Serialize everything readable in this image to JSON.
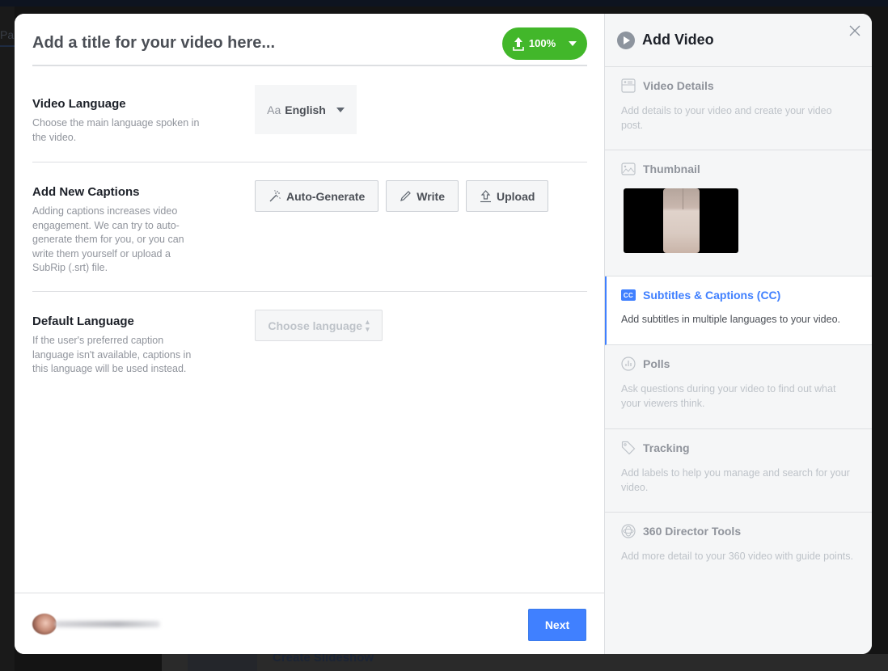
{
  "background": {
    "tab_fragment": "Pa",
    "bottom_item": "Create Slideshow"
  },
  "header": {
    "title": "Add a title for your video here...",
    "upload_progress_label": "100%",
    "upload_progress_percent": 100,
    "upload_color": "#42b72a"
  },
  "sections": {
    "video_language": {
      "title": "Video Language",
      "description": "Choose the main language spoken in the video.",
      "select_prefix": "Aa",
      "selected": "English"
    },
    "add_captions": {
      "title": "Add New Captions",
      "description": "Adding captions increases video engagement. We can try to auto-generate them for you, or you can write them yourself or upload a SubRip (.srt) file.",
      "buttons": [
        {
          "label": "Auto-Generate",
          "icon": "magic-wand-icon"
        },
        {
          "label": "Write",
          "icon": "pencil-icon"
        },
        {
          "label": "Upload",
          "icon": "upload-icon"
        }
      ]
    },
    "default_language": {
      "title": "Default Language",
      "description": "If the user's preferred caption language isn't available, captions in this language will be used instead.",
      "placeholder": "Choose language"
    }
  },
  "footer": {
    "next_label": "Next",
    "accent": "#4080ff"
  },
  "sidebar": {
    "title": "Add Video",
    "steps": [
      {
        "title": "Video Details",
        "description": "Add details to your video and create your video post.",
        "icon": "video-details-icon",
        "active": false
      },
      {
        "title": "Thumbnail",
        "description": "",
        "icon": "image-icon",
        "active": false
      },
      {
        "title": "Subtitles & Captions (CC)",
        "description": "Add subtitles in multiple languages to your video.",
        "icon": "cc-icon",
        "active": true,
        "badge": "CC"
      },
      {
        "title": "Polls",
        "description": "Ask questions during your video to find out what your viewers think.",
        "icon": "poll-icon",
        "active": false
      },
      {
        "title": "Tracking",
        "description": "Add labels to help you manage and search for your video.",
        "icon": "tag-icon",
        "active": false
      },
      {
        "title": "360 Director Tools",
        "description": "Add more detail to your 360 video with guide points.",
        "icon": "360-icon",
        "active": false
      }
    ]
  }
}
